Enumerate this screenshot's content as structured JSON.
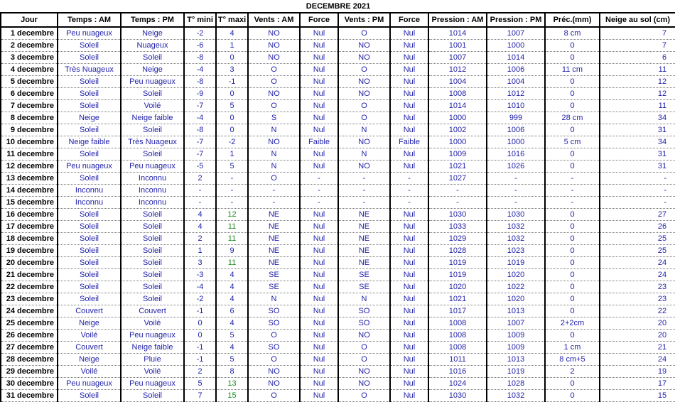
{
  "sheet": {
    "title": "DECEMBRE  2021",
    "headers": [
      "Jour",
      "Temps : AM",
      "Temps : PM",
      "T° mini",
      "T° maxi",
      "Vents : AM",
      "Force",
      "Vents : PM",
      "Force",
      "Pression : AM",
      "Pression : PM",
      "Préc.(mm)",
      "Neige au sol (cm)"
    ],
    "rows": [
      [
        "1 decembre",
        "Peu nuageux",
        "Neige",
        "-2",
        "4",
        "NO",
        "Nul",
        "O",
        "Nul",
        "1014",
        "1007",
        "8 cm",
        "7"
      ],
      [
        "2 decembre",
        "Soleil",
        "Nuageux",
        "-6",
        "1",
        "NO",
        "Nul",
        "NO",
        "Nul",
        "1001",
        "1000",
        "0",
        "7"
      ],
      [
        "3 decembre",
        "Soleil",
        "Soleil",
        "-8",
        "0",
        "NO",
        "Nul",
        "NO",
        "Nul",
        "1007",
        "1014",
        "0",
        "6"
      ],
      [
        "4 decembre",
        "Très Nuageux",
        "Neige",
        "-4",
        "3",
        "O",
        "Nul",
        "O",
        "Nul",
        "1012",
        "1006",
        "11 cm",
        "11"
      ],
      [
        "5 decembre",
        "Soleil",
        "Peu nuageux",
        "-8",
        "-1",
        "O",
        "Nul",
        "NO",
        "Nul",
        "1004",
        "1004",
        "0",
        "12"
      ],
      [
        "6 decembre",
        "Soleil",
        "Soleil",
        "-9",
        "0",
        "NO",
        "Nul",
        "NO",
        "Nul",
        "1008",
        "1012",
        "0",
        "12"
      ],
      [
        "7 decembre",
        "Soleil",
        "Voilé",
        "-7",
        "5",
        "O",
        "Nul",
        "O",
        "Nul",
        "1014",
        "1010",
        "0",
        "11"
      ],
      [
        "8 decembre",
        "Neige",
        "Neige faible",
        "-4",
        "0",
        "S",
        "Nul",
        "O",
        "Nul",
        "1000",
        "999",
        "28 cm",
        "34"
      ],
      [
        "9 decembre",
        "Soleil",
        "Soleil",
        "-8",
        "0",
        "N",
        "Nul",
        "N",
        "Nul",
        "1002",
        "1006",
        "0",
        "31"
      ],
      [
        "10 decembre",
        "Neige faible",
        "Très Nuageux",
        "-7",
        "-2",
        "NO",
        "Faible",
        "NO",
        "Faible",
        "1000",
        "1000",
        "5 cm",
        "34"
      ],
      [
        "11 decembre",
        "Soleil",
        "Soleil",
        "-7",
        "1",
        "N",
        "Nul",
        "N",
        "Nul",
        "1009",
        "1016",
        "0",
        "31"
      ],
      [
        "12 decembre",
        "Peu nuageux",
        "Peu nuageux",
        "-5",
        "5",
        "N",
        "Nul",
        "NO",
        "Nul",
        "1021",
        "1026",
        "0",
        "31"
      ],
      [
        "13 decembre",
        "Soleil",
        "Inconnu",
        "2",
        "-",
        "O",
        "-",
        "-",
        "-",
        "1027",
        "-",
        "-",
        "-"
      ],
      [
        "14 decembre",
        "Inconnu",
        "Inconnu",
        "-",
        "-",
        "-",
        "-",
        "-",
        "-",
        "-",
        "-",
        "-",
        "-"
      ],
      [
        "15 decembre",
        "Inconnu",
        "Inconnu",
        "-",
        "-",
        "-",
        "-",
        "-",
        "-",
        "-",
        "-",
        "-",
        "-"
      ],
      [
        "16 decembre",
        "Soleil",
        "Soleil",
        "4",
        "12",
        "NE",
        "Nul",
        "NE",
        "Nul",
        "1030",
        "1030",
        "0",
        "27"
      ],
      [
        "17 decembre",
        "Soleil",
        "Soleil",
        "4",
        "11",
        "NE",
        "Nul",
        "NE",
        "Nul",
        "1033",
        "1032",
        "0",
        "26"
      ],
      [
        "18 decembre",
        "Soleil",
        "Soleil",
        "2",
        "11",
        "NE",
        "Nul",
        "NE",
        "Nul",
        "1029",
        "1032",
        "0",
        "25"
      ],
      [
        "19 decembre",
        "Soleil",
        "Soleil",
        "1",
        "9",
        "NE",
        "Nul",
        "NE",
        "Nul",
        "1028",
        "1023",
        "0",
        "25"
      ],
      [
        "20 decembre",
        "Soleil",
        "Soleil",
        "3",
        "11",
        "NE",
        "Nul",
        "NE",
        "Nul",
        "1019",
        "1019",
        "0",
        "24"
      ],
      [
        "21 decembre",
        "Soleil",
        "Soleil",
        "-3",
        "4",
        "SE",
        "Nul",
        "SE",
        "Nul",
        "1019",
        "1020",
        "0",
        "24"
      ],
      [
        "22 decembre",
        "Soleil",
        "Soleil",
        "-4",
        "4",
        "SE",
        "Nul",
        "SE",
        "Nul",
        "1020",
        "1022",
        "0",
        "23"
      ],
      [
        "23 decembre",
        "Soleil",
        "Soleil",
        "-2",
        "4",
        "N",
        "Nul",
        "N",
        "Nul",
        "1021",
        "1020",
        "0",
        "23"
      ],
      [
        "24 decembre",
        "Couvert",
        "Couvert",
        "-1",
        "6",
        "SO",
        "Nul",
        "SO",
        "Nul",
        "1017",
        "1013",
        "0",
        "22"
      ],
      [
        "25 decembre",
        "Neige",
        "Voilé",
        "0",
        "4",
        "SO",
        "Nul",
        "SO",
        "Nul",
        "1008",
        "1007",
        "2+2cm",
        "20"
      ],
      [
        "26 decembre",
        "Voilé",
        "Peu nuageux",
        "0",
        "5",
        "O",
        "Nul",
        "NO",
        "Nul",
        "1008",
        "1009",
        "0",
        "20"
      ],
      [
        "27 decembre",
        "Couvert",
        "Neige faible",
        "-1",
        "4",
        "SO",
        "Nul",
        "O",
        "Nul",
        "1008",
        "1009",
        "1 cm",
        "21"
      ],
      [
        "28 decembre",
        "Neige",
        "Pluie",
        "-1",
        "5",
        "O",
        "Nul",
        "O",
        "Nul",
        "1011",
        "1013",
        "8 cm+5",
        "24"
      ],
      [
        "29 decembre",
        "Voilé",
        "Voilé",
        "2",
        "8",
        "NO",
        "Nul",
        "NO",
        "Nul",
        "1016",
        "1019",
        "2",
        "19"
      ],
      [
        "30 decembre",
        "Peu nuageux",
        "Peu nuageux",
        "5",
        "13",
        "NO",
        "Nul",
        "NO",
        "Nul",
        "1024",
        "1028",
        "0",
        "17"
      ],
      [
        "31 decembre",
        "Soleil",
        "Soleil",
        "7",
        "15",
        "O",
        "Nul",
        "O",
        "Nul",
        "1030",
        "1032",
        "0",
        "15"
      ]
    ],
    "colors": {
      "text_blue": "#1f1fa8",
      "text_green": "#1e8a1e",
      "grid_black": "#000000"
    }
  }
}
